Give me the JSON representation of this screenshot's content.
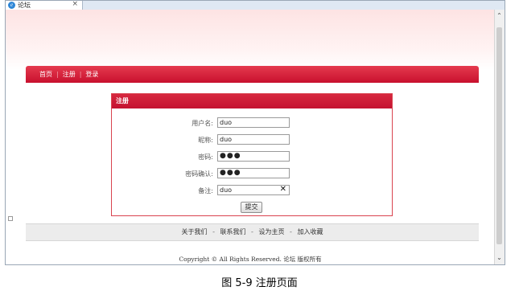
{
  "browser": {
    "tab_title": "论坛",
    "tab_icon": "ie-icon",
    "close_glyph": "×",
    "scroll_up": "⌃",
    "scroll_down": "⌄"
  },
  "nav": {
    "items": [
      "首页",
      "注册",
      "登录"
    ],
    "sep": "|"
  },
  "form": {
    "header": "注册",
    "fields": [
      {
        "label": "用户名:",
        "value": "duo"
      },
      {
        "label": "昵称:",
        "value": "duo"
      },
      {
        "label": "密码:",
        "value": "●●●"
      },
      {
        "label": "密码确认:",
        "value": "●●●"
      },
      {
        "label": "备注:",
        "value": "duo"
      }
    ],
    "clear_glyph": "✕",
    "submit_label": "提交"
  },
  "footer": {
    "links": [
      "关于我们",
      "联系我们",
      "设为主页",
      "加入收藏"
    ],
    "sep": "-",
    "copyright": "Copyright © All Rights Reserved. 论坛 版权所有"
  },
  "caption": "图 5-9 注册页面",
  "colors": {
    "accent": "#c8102e",
    "header_gradient_top": "#fde3e3"
  }
}
